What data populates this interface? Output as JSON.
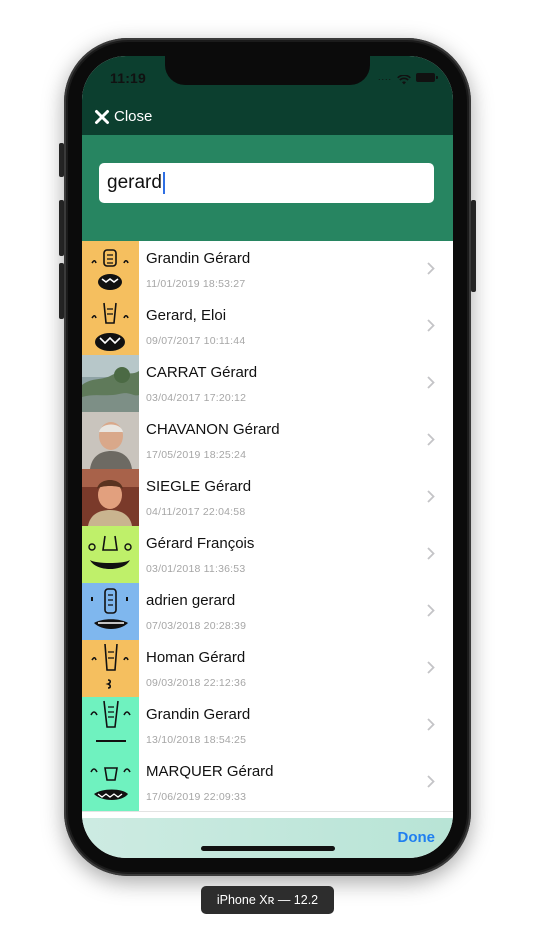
{
  "status": {
    "time": "11:19",
    "signal": "...."
  },
  "nav": {
    "close_label": "Close"
  },
  "search": {
    "value": "gerard"
  },
  "results": [
    {
      "name": "Grandin Gérard",
      "date": "11/01/2019 18:53:27",
      "avatar": "face-orange-1"
    },
    {
      "name": "Gerard, Eloi",
      "date": "09/07/2017 10:11:44",
      "avatar": "face-orange-2"
    },
    {
      "name": "CARRAT Gérard",
      "date": "03/04/2017 17:20:12",
      "avatar": "photo-landscape"
    },
    {
      "name": "CHAVANON Gérard",
      "date": "17/05/2019 18:25:24",
      "avatar": "photo-elderly-man"
    },
    {
      "name": "SIEGLE Gérard",
      "date": "04/11/2017 22:04:58",
      "avatar": "photo-man"
    },
    {
      "name": "Gérard François",
      "date": "03/01/2018 11:36:53",
      "avatar": "face-lime"
    },
    {
      "name": "adrien gerard",
      "date": "07/03/2018 20:28:39",
      "avatar": "face-blue"
    },
    {
      "name": "Homan Gérard",
      "date": "09/03/2018 22:12:36",
      "avatar": "face-orange-3"
    },
    {
      "name": "Grandin Gerard",
      "date": "13/10/2018 18:54:25",
      "avatar": "face-mint-1"
    },
    {
      "name": "MARQUER Gérard",
      "date": "17/06/2019 22:09:33",
      "avatar": "face-mint-2"
    }
  ],
  "toolbar": {
    "done_label": "Done"
  },
  "device": {
    "label": "iPhone Xʀ — 12.2"
  },
  "colors": {
    "nav_bg": "#0c3f2f",
    "search_bg": "#278561",
    "accent": "#1f7ff0",
    "face_orange": "#f5bf5f",
    "face_lime": "#bff06a",
    "face_blue": "#7fb7ee",
    "face_mint": "#6ff2bf"
  }
}
